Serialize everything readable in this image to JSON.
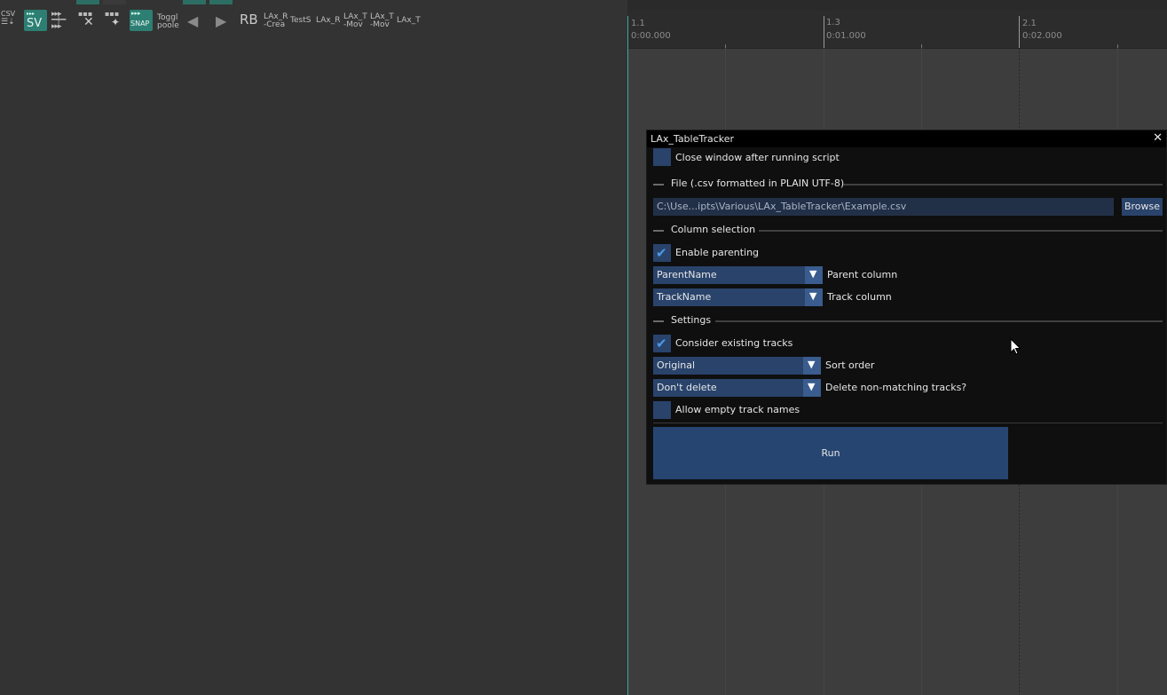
{
  "toolbar": {
    "csv_label": "CSV",
    "sv_label": "SV",
    "snap_label": "SNAP",
    "toggle_label_1": "Toggl",
    "toggle_label_2": "poole",
    "rb_label": "RB",
    "lax_r_crea_1": "LAx_R",
    "lax_r_crea_2": "-Crea",
    "tests_label": "TestS",
    "lax_r_label": "LAx_R",
    "lax_t_mov1_1": "LAx_T",
    "lax_t_mov1_2": "-Mov",
    "lax_t_mov2_1": "LAx_T",
    "lax_t_mov2_2": "-Mov",
    "lax_t_label": "LAx_T",
    "icons": [
      "csv-icon",
      "sv-icon",
      "grid-icon",
      "close-icon",
      "move-icon",
      "snap-icon",
      "toggle-icon",
      "play-reverse-icon",
      "play-icon",
      "rb-icon"
    ]
  },
  "ruler": {
    "markers": [
      {
        "bar": "1.1",
        "time": "0:00.000"
      },
      {
        "bar": "1.3",
        "time": "0:01.000"
      },
      {
        "bar": "2.1",
        "time": "0:02.000"
      }
    ]
  },
  "dialog": {
    "title": "LAx_TableTracker",
    "close_symbol": "✕",
    "close_after_label": "Close window after running script",
    "close_after_checked": false,
    "file_section": "File (.csv formatted in PLAIN UTF-8)",
    "file_path": "C:\\Use...ipts\\Various\\LAx_TableTracker\\Example.csv",
    "browse_label": "Browse",
    "column_section": "Column selection",
    "enable_parenting_label": "Enable parenting",
    "enable_parenting_checked": true,
    "parent_combo_value": "ParentName",
    "parent_column_label": "Parent column",
    "track_combo_value": "TrackName",
    "track_column_label": "Track column",
    "settings_section": "Settings",
    "consider_existing_label": "Consider existing tracks",
    "consider_existing_checked": true,
    "sort_combo_value": "Original",
    "sort_order_label": "Sort order",
    "delete_combo_value": "Don't delete",
    "delete_label": "Delete non-matching tracks?",
    "allow_empty_label": "Allow empty track names",
    "allow_empty_checked": false,
    "run_label": "Run",
    "check_mark": "✔",
    "dropdown_arrow": "▼"
  },
  "colors": {
    "accent": "#29436b",
    "run_button": "#264571",
    "check": "#4d99e6",
    "teal": "#2d7f73"
  }
}
